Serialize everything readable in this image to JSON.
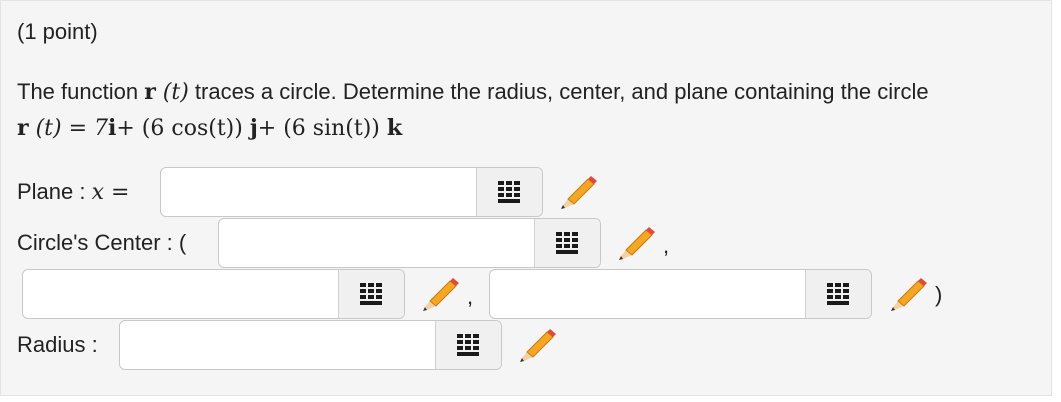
{
  "points_label": "(1 point)",
  "question": {
    "text_before": "The function ",
    "fn_name": "r",
    "fn_arg": " (t)",
    "text_after": " traces a circle. Determine the radius, center, and plane containing the circle"
  },
  "formula": {
    "lhs_name": "r",
    "lhs_arg": " (t) = ",
    "coef_i": "7",
    "unit_i": "i",
    "plus1": "+ (6 cos(t)) ",
    "unit_j": "j",
    "plus2": "+ (6 sin(t)) ",
    "unit_k": "k"
  },
  "fields": {
    "plane_label_text": "Plane : ",
    "plane_label_var": "x",
    "plane_label_eq": " =",
    "plane_value": "",
    "center_label": "Circle's Center : (",
    "center_x_value": "",
    "center_y_value": "",
    "center_z_value": "",
    "separator_1": ",",
    "separator_2": ",",
    "close_paren": ")",
    "radius_label": "Radius :",
    "radius_value": ""
  },
  "icons": {
    "keypad": "keypad-grid-icon",
    "edit": "pencil-icon"
  },
  "colors": {
    "background": "#f5f5f5",
    "pencil_body": "#f5a623",
    "pencil_tip": "#e04a3a"
  }
}
